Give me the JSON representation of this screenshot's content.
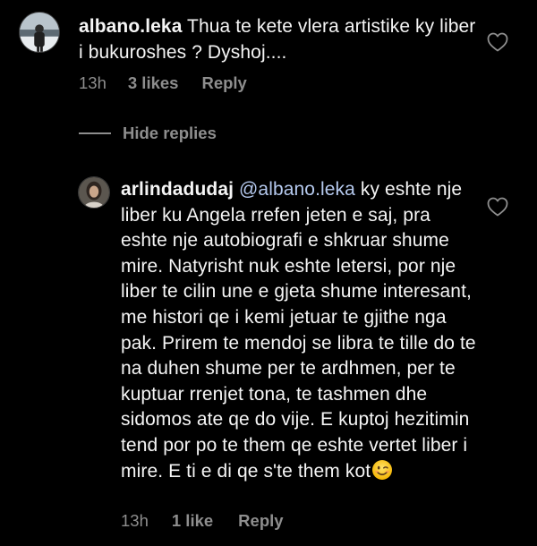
{
  "colors": {
    "background": "#000000",
    "text": "#f5f5f5",
    "secondary": "#8e8e8e",
    "mention": "#b5c9ee"
  },
  "comment1": {
    "username": "albano.leka",
    "text": " Thua te kete vlera artistike ky liber i bukuroshes ? Dyshoj....",
    "time": "13h",
    "likes": "3 likes",
    "reply_label": "Reply",
    "avatar_icon": "profile-photo"
  },
  "replies": {
    "hide_label": "Hide replies"
  },
  "comment2": {
    "username": "arlindadudaj",
    "mention": "@albano.leka",
    "text": " ky eshte nje liber ku Angela rrefen jeten e saj, pra eshte nje autobiografi e shkruar shume mire. Natyrisht nuk eshte letersi, por nje liber te cilin une e gjeta shume interesant, me histori qe i kemi jetuar te gjithe nga pak. Prirem te mendoj se libra te tille do te na duhen shume per te ardhmen, per te kuptuar rrenjet tona, te tashmen dhe sidomos ate qe do vije. E kuptoj hezitimin tend por po te them qe eshte vertet liber i mire. E ti e di qe s'te them kot",
    "emoji": "winking-face-emoji",
    "time": "13h",
    "likes": "1 like",
    "reply_label": "Reply",
    "avatar_icon": "profile-photo"
  },
  "icons": {
    "like": "heart-outline-icon"
  }
}
